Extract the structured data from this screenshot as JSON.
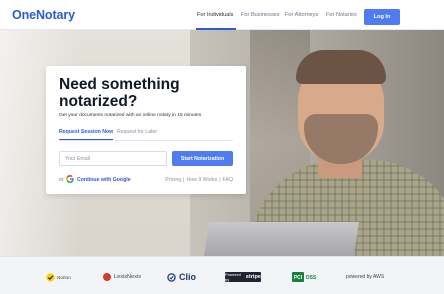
{
  "nav": {
    "logo": "OneNotary",
    "links": [
      "For Individuals",
      "For Businesses",
      "For Attorneys",
      "For Notaries"
    ],
    "login": "Log In",
    "accent": "#2a5bd7",
    "button_color": "#4f7cf0"
  },
  "hero": {
    "headline": "Need something notarized?",
    "subline": "Get your documents notarized with an online notary in 15 minutes",
    "tabs": [
      "Request Session Now",
      "Request for Later"
    ],
    "email_placeholder": "Your Email",
    "start_button": "Start Notarization",
    "or": "or",
    "google_link": "Continue with Google",
    "links": [
      "Pricing",
      "How It Works",
      "FAQ"
    ],
    "separator": "|"
  },
  "partners": {
    "norton": "Norton",
    "lexis": "LexisNexis",
    "clio": "Clio",
    "stripe_prefix": "Powered by",
    "stripe": "stripe",
    "pci": "PCI DSS",
    "aws": "powered by AWS"
  }
}
